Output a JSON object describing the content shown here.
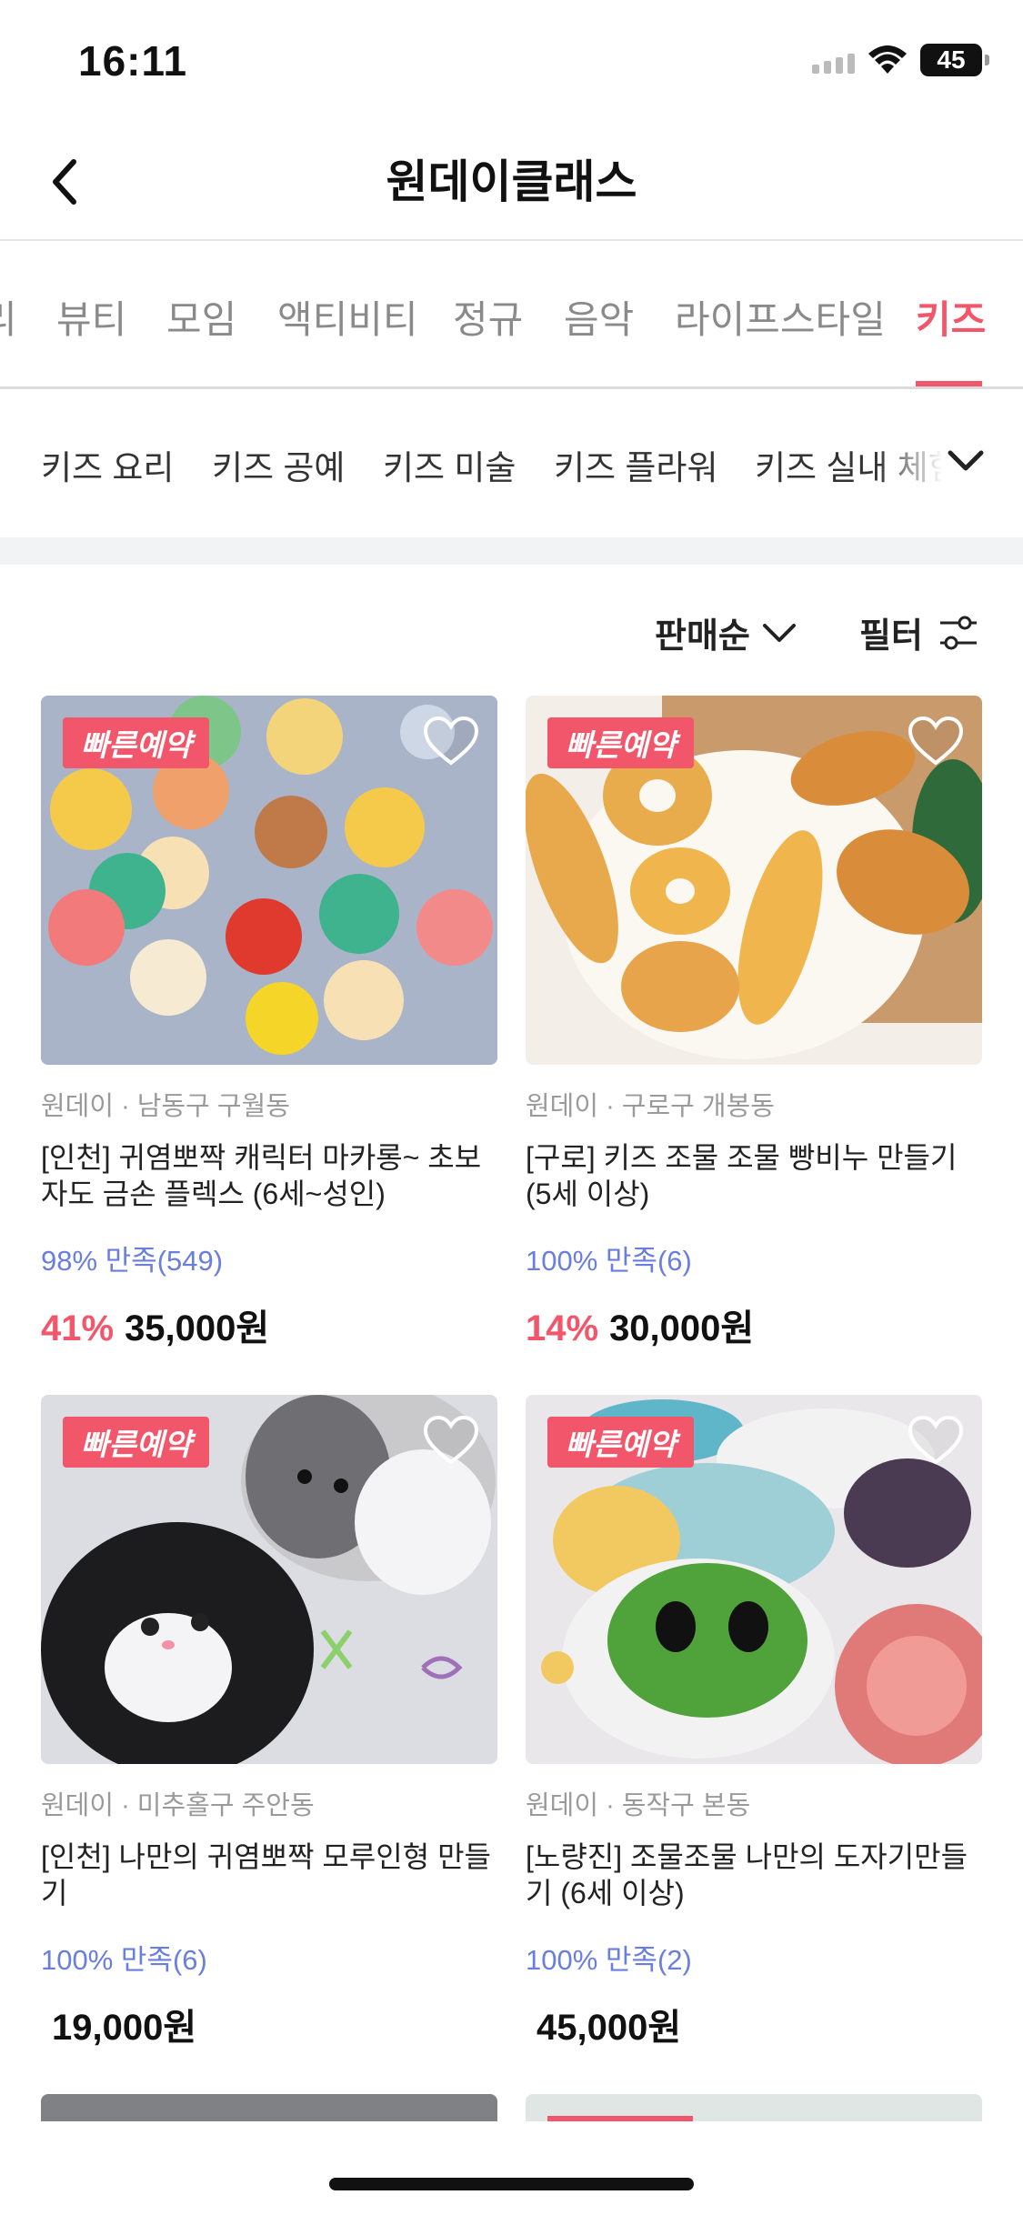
{
  "status_bar": {
    "time": "16:11",
    "battery": "45"
  },
  "header": {
    "title": "원데이클래스"
  },
  "category_tabs": [
    {
      "label": "뷰티"
    },
    {
      "label": "모임"
    },
    {
      "label": "액티비티"
    },
    {
      "label": "정규"
    },
    {
      "label": "음악"
    },
    {
      "label": "라이프스타일"
    },
    {
      "label": "키즈",
      "active": true
    }
  ],
  "sub_tabs": [
    {
      "label": "키즈 요리"
    },
    {
      "label": "키즈 공예"
    },
    {
      "label": "키즈 미술"
    },
    {
      "label": "키즈 플라워"
    },
    {
      "label": "키즈 실내 체험"
    }
  ],
  "sort": {
    "label": "판매순"
  },
  "filter": {
    "label": "필터"
  },
  "colors": {
    "accent": "#f2566a",
    "rating": "#6a7ee0"
  },
  "cards": [
    {
      "badge": "빠른예약",
      "location": "원데이 · 남동구 구월동",
      "title": "[인천] 귀염뽀짝 캐릭터 마카롱~ 초보자도 금손 플렉스 (6세~성인)",
      "rating": "98% 만족(549)",
      "discount": "41%",
      "price": "35,000원",
      "image": "macaron-photo"
    },
    {
      "badge": "빠른예약",
      "location": "원데이 · 구로구 개봉동",
      "title": "[구로] 키즈 조물 조물 빵비누 만들기 (5세 이상)",
      "rating": "100% 만족(6)",
      "discount": "14%",
      "price": "30,000원",
      "image": "bread-soap-photo"
    },
    {
      "badge": "빠른예약",
      "location": "원데이 · 미추홀구 주안동",
      "title": "[인천] 나만의 귀염뽀짝 모루인형 만들기",
      "rating": "100% 만족(6)",
      "discount": "",
      "price": "19,000원",
      "image": "mohair-doll-photo"
    },
    {
      "badge": "빠른예약",
      "location": "원데이 · 동작구 본동",
      "title": "[노량진] 조물조물 나만의 도자기만들기 (6세 이상)",
      "rating": "100% 만족(2)",
      "discount": "",
      "price": "45,000원",
      "image": "ceramic-plate-photo"
    }
  ]
}
